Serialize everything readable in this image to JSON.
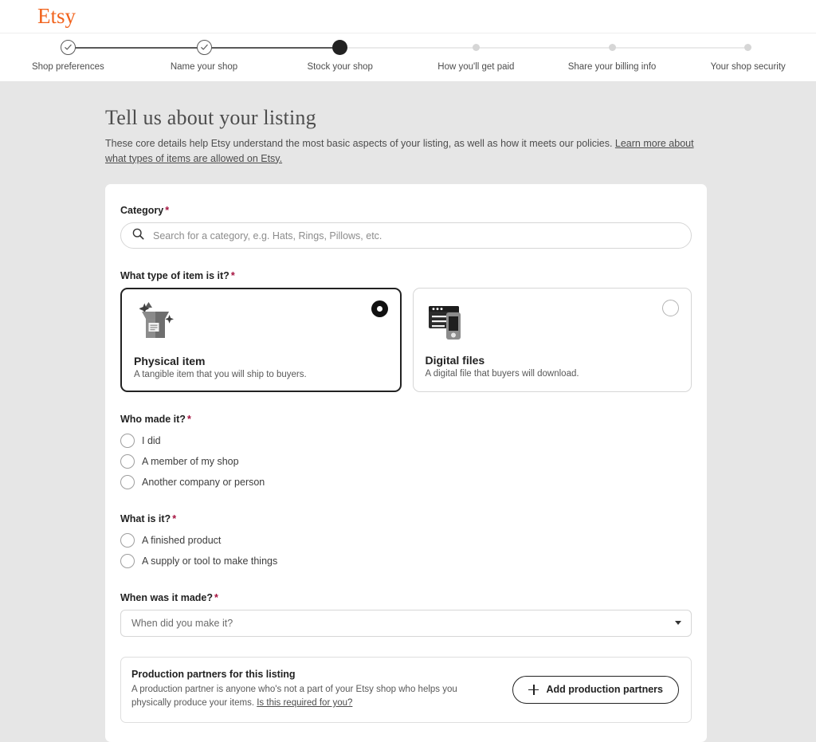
{
  "brand": {
    "name": "Etsy",
    "color": "#f1641e"
  },
  "stepper": {
    "steps": [
      {
        "label": "Shop preferences",
        "state": "done"
      },
      {
        "label": "Name your shop",
        "state": "done"
      },
      {
        "label": "Stock your shop",
        "state": "active"
      },
      {
        "label": "How you'll get paid",
        "state": "todo"
      },
      {
        "label": "Share your billing info",
        "state": "todo"
      },
      {
        "label": "Your shop security",
        "state": "todo"
      }
    ]
  },
  "page": {
    "title": "Tell us about your listing",
    "description": "These core details help Etsy understand the most basic aspects of your listing, as well as how it meets our policies. ",
    "description_link": "Learn more about what types of items are allowed on Etsy."
  },
  "category": {
    "label": "Category",
    "required_mark": "*",
    "placeholder": "Search for a category, e.g. Hats, Rings, Pillows, etc.",
    "value": ""
  },
  "item_type": {
    "label": "What type of item is it?",
    "required_mark": "*",
    "options": [
      {
        "title": "Physical item",
        "subtitle": "A tangible item that you will ship to buyers.",
        "selected": true
      },
      {
        "title": "Digital files",
        "subtitle": "A digital file that buyers will download.",
        "selected": false
      }
    ]
  },
  "who_made_it": {
    "label": "Who made it?",
    "required_mark": "*",
    "options": [
      {
        "label": "I did",
        "selected": false
      },
      {
        "label": "A member of my shop",
        "selected": false
      },
      {
        "label": "Another company or person",
        "selected": false
      }
    ]
  },
  "what_is_it": {
    "label": "What is it?",
    "required_mark": "*",
    "options": [
      {
        "label": "A finished product",
        "selected": false
      },
      {
        "label": "A supply or tool to make things",
        "selected": false
      }
    ]
  },
  "when_made": {
    "label": "When was it made?",
    "required_mark": "*",
    "placeholder": "When did you make it?",
    "value": "When did you make it?"
  },
  "production_partners": {
    "title": "Production partners for this listing",
    "description": "A production partner is anyone who's not a part of your Etsy shop who helps you physically produce your items. ",
    "description_link": "Is this required for you?",
    "button_label": "Add production partners"
  }
}
